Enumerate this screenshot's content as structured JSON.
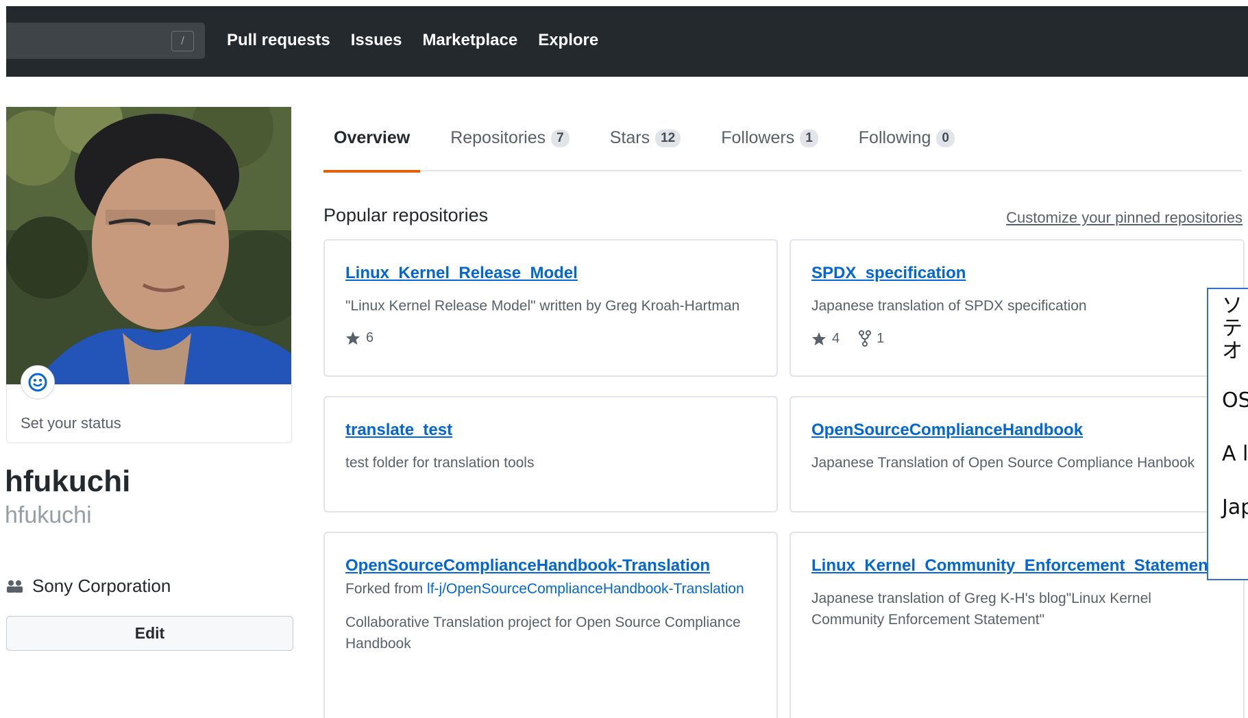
{
  "topbar": {
    "search_shortcut": "/",
    "nav": [
      "Pull requests",
      "Issues",
      "Marketplace",
      "Explore"
    ]
  },
  "profile": {
    "status_label": "Set your status",
    "full_name": "hfukuchi",
    "username": "hfukuchi",
    "organization": "Sony Corporation",
    "edit_label": "Edit"
  },
  "tabs": [
    {
      "label": "Overview",
      "count": null,
      "active": true
    },
    {
      "label": "Repositories",
      "count": "7"
    },
    {
      "label": "Stars",
      "count": "12"
    },
    {
      "label": "Followers",
      "count": "1"
    },
    {
      "label": "Following",
      "count": "0"
    }
  ],
  "popular": {
    "title": "Popular repositories",
    "customize_label": "Customize your pinned repositories"
  },
  "repos": [
    {
      "name": "Linux_Kernel_Release_Model",
      "description": "\"Linux Kernel Release Model\" written by Greg Kroah-Hartman",
      "stars": "6"
    },
    {
      "name": "SPDX_specification",
      "description": "Japanese translation of SPDX specification",
      "stars": "4",
      "forks": "1"
    },
    {
      "name": "translate_test",
      "description": "test folder for translation tools"
    },
    {
      "name": "OpenSourceComplianceHandbook",
      "description": "Japanese Translation of Open Source Compliance Hanbook"
    },
    {
      "name": "OpenSourceComplianceHandbook-Translation",
      "forked_prefix": "Forked from ",
      "forked_link": "lf-j/OpenSourceComplianceHandbook-Translation",
      "description": "Collaborative Translation project for Open Source Compliance Handbook"
    },
    {
      "name": "Linux_Kernel_Community_Enforcement_Statement",
      "description": "Japanese translation of Greg K-H's blog\"Linux Kernel Community Enforcement Statement\""
    }
  ],
  "overlay": {
    "lines": [
      "ソ",
      "テ",
      "オ",
      "",
      "OS",
      "",
      "A l",
      "",
      "Jap"
    ]
  },
  "colors": {
    "header_bg": "#24292e",
    "link": "#0366d6",
    "tab_underline": "#e36209",
    "overlay_border": "#2f6fd6"
  }
}
